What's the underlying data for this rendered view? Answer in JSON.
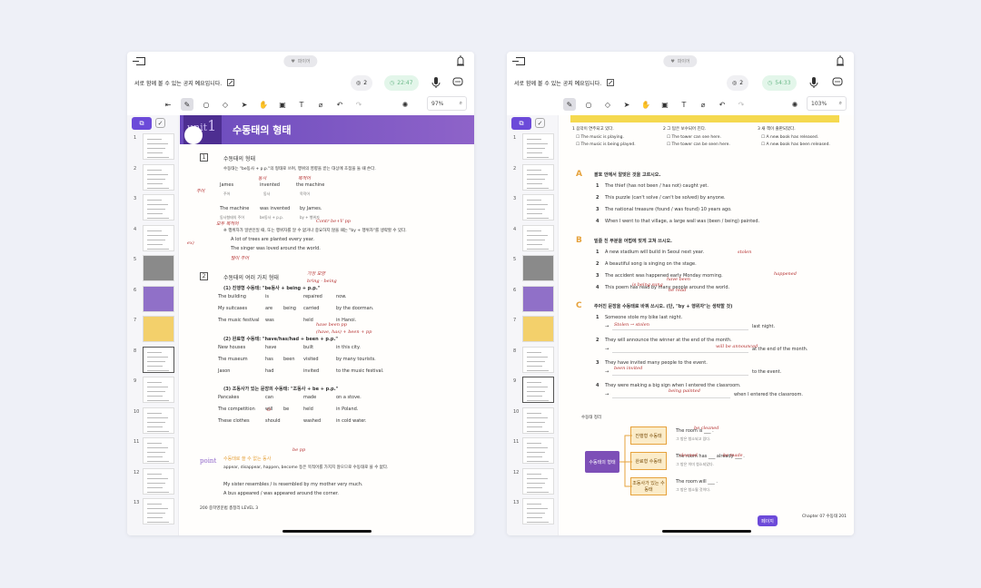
{
  "left": {
    "status_pill": "파이어",
    "notice": "서로 함께 볼 수 있는 공지 예요입니다.",
    "participants": "2",
    "timer": "22:47",
    "zoom": "97%",
    "thumbnails": [
      "1",
      "2",
      "3",
      "4",
      "5",
      "6",
      "7",
      "8",
      "9",
      "10",
      "11",
      "12",
      "13"
    ],
    "unit_label": "unit",
    "unit_number": "1",
    "title": "수동태의 형태",
    "section1_box": "1",
    "section1_heading": "수동태의 형태",
    "section1_line": "수동태는 \"be동사 + p.p.\"의 형태로 쓰며, 행위의 영향을 받는 대상에 초점을 둘 때 쓴다.",
    "s1_row1": [
      "James",
      "invented",
      "the machine"
    ],
    "s1_row1_labels": [
      "주어",
      "동사",
      "목적어"
    ],
    "s1_row2": [
      "The machine",
      "was invented",
      "by James."
    ],
    "s1_row2_labels": [
      "동사형태의 주어",
      "be동사 + p.p.",
      "by + 행위자"
    ],
    "s1_note": "※ 행위자가 일반인일 때, 또는 행위자를 알 수 없거나 중요하지 않을 때는 \"by + 행위자\"를 생략할 수 있다.",
    "s1_ex1": "A lot of trees are planted every year.",
    "s1_ex2": "The singer was loved around the world.",
    "section2_box": "2",
    "section2_heading": "수동태의 여러 가지 형태",
    "s2_sub1": "(1) 진행형 수동태: \"be동사 + being + p.p.\"",
    "s2_t1": [
      [
        "The building",
        "is",
        "",
        "repaired",
        "now."
      ],
      [
        "My suitcases",
        "are",
        "being",
        "carried",
        "by the doorman."
      ],
      [
        "The music festival",
        "was",
        "",
        "held",
        "in Hanoi."
      ]
    ],
    "s2_sub2": "(2) 완료형 수동태: \"have/has/had + been + p.p.\"",
    "s2_t2": [
      [
        "New houses",
        "have",
        "",
        "built",
        "in this city."
      ],
      [
        "The museum",
        "has",
        "been",
        "visited",
        "by many tourists."
      ],
      [
        "Jason",
        "had",
        "",
        "invited",
        "to the music festival."
      ]
    ],
    "s2_sub3": "(3) 조동사가 있는 문장의 수동태: \"조동사 + be + p.p.\"",
    "s2_t3": [
      [
        "Pancakes",
        "can",
        "",
        "made",
        "on a stove."
      ],
      [
        "The competition",
        "will",
        "be",
        "held",
        "in Poland."
      ],
      [
        "These clothes",
        "should",
        "",
        "washed",
        "in cold water."
      ]
    ],
    "point_label": "point",
    "point_heading": "수동태로 쓸 수 없는 동사",
    "point_text": "appear, disappear, happen, become 등은 목적어를 가지지 않으므로 수동태로 쓸 수 없다.",
    "point_ex1": "My sister resembles / is resembled by my mother very much.",
    "point_ex2": "A bus appeared / was appeared around the corner.",
    "footer": "200  중학영문법 총정리  LEVEL 3"
  },
  "right": {
    "status_pill": "파이어",
    "notice": "서로 함께 볼 수 있는 공지 예요입니다.",
    "participants": "2",
    "timer": "54:33",
    "zoom": "103%",
    "thumbnails": [
      "1",
      "2",
      "3",
      "4",
      "5",
      "6",
      "7",
      "8",
      "9",
      "10",
      "11",
      "12",
      "13"
    ],
    "top_items": [
      "1 음악이 연주되고 있다.",
      "2 그 탑은 보수되어 진다.",
      "3 새 책이 출판되었다."
    ],
    "top_choices": [
      [
        "The music is playing.",
        "The music is being played."
      ],
      [
        "The tower can see here.",
        "The tower can be seen here."
      ],
      [
        "A new book has released.",
        "A new book has been released."
      ]
    ],
    "secA_letter": "A",
    "secA_heading": "괄호 안에서 알맞은 것을 고르시오.",
    "secA_items": [
      "The thief (has not been / has not) caught yet.",
      "This puzzle (can't solve / can't be solved) by anyone.",
      "The national treasure (found / was found) 10 years ago.",
      "When I went to that village, a large wall was (been / being) painted."
    ],
    "secB_letter": "B",
    "secB_heading": "밑줄 친 부분을 어법에 맞게 고쳐 쓰시오.",
    "secB_items": [
      "A new stadium will build in Seoul next year.",
      "A beautiful song is singing on the stage.",
      "The accident was happened early Monday morning.",
      "This poem has read by many people around the world."
    ],
    "secC_letter": "C",
    "secC_heading": "주어진 문장을 수동태로 바꿔 쓰시오. (단, \"by + 행위자\"는 생략할 것)",
    "secC_items": [
      "Someone stole my bike last night.",
      "They will announce the winner at the end of the month.",
      "They have invited many people to the event.",
      "They were making a big sign when I entered the classroom."
    ],
    "secC_tails": [
      "last night.",
      "at the end of the month.",
      "to the event.",
      "when I entered the classroom."
    ],
    "diagram_main": "수동태의 형태",
    "diagram_boxes": [
      "진행형 수동태",
      "완료형 수동태",
      "조동사가 있는 수동태"
    ],
    "diagram_sents": [
      "The room is ___ .",
      "The room has ___ already ___ .",
      "The room will ___ ."
    ],
    "diagram_subs": [
      "그 방은 청소되고 있다.",
      "그 방은 이미 청소되었다.",
      "그 방은 청소될 것이다."
    ],
    "fab_label": "페이지",
    "footer": "Chapter 07 수동태  201",
    "annotation_label": "수동태 정리"
  },
  "ink": {
    "left": [
      "주어",
      "동사",
      "목적어",
      "모두 목적어",
      "Contr be+V pp",
      "ex)",
      "많이 주어",
      "bring - being",
      "가장 모양",
      "have been pp",
      "(have, has) + been + pp",
      "be pp",
      "O"
    ],
    "right": [
      "stolen",
      "Stolen → stolen",
      "will be announced",
      "been invited",
      "have been",
      "being painted",
      "be made",
      "be cleaned",
      "cleaned",
      "happened",
      "be read",
      "is being sung"
    ]
  }
}
